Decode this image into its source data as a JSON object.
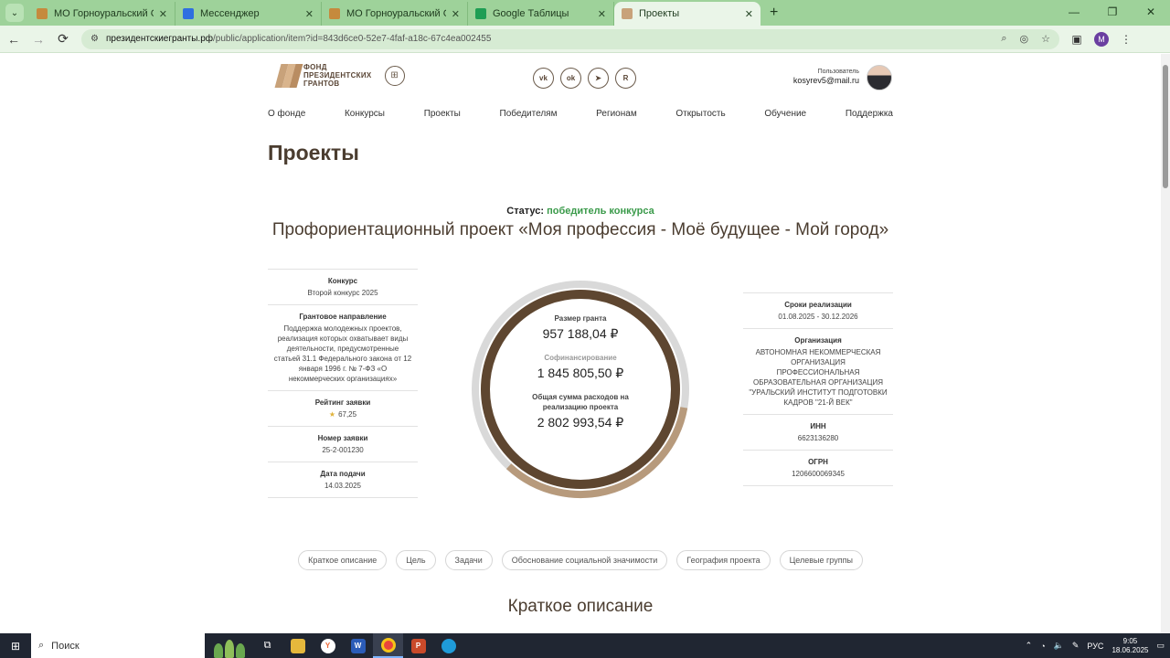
{
  "browser": {
    "tabs": [
      {
        "title": "МО Горноуральский Свердло",
        "icon_color": "#c58a3d",
        "active": false
      },
      {
        "title": "Мессенджер",
        "icon_color": "#2f6fe0",
        "active": false
      },
      {
        "title": "МО Горноуральский Свердло",
        "icon_color": "#c58a3d",
        "active": false
      },
      {
        "title": "Google Таблицы",
        "icon_color": "#1e9e54",
        "active": false
      },
      {
        "title": "Проекты",
        "icon_color": "#c8a27a",
        "active": true
      }
    ],
    "url_host": "президентскиегранты.рф",
    "url_path": "/public/application/item?id=843d6ce0-52e7-4faf-a18c-67c4ea002455",
    "profile_letter": "M"
  },
  "site": {
    "logo_line1": "ФОНД",
    "logo_line2": "ПРЕЗИДЕНТСКИХ",
    "logo_line3": "ГРАНТОВ",
    "socials": [
      "vk-icon",
      "ok-icon",
      "telegram-icon",
      "rutube-icon"
    ],
    "user_label": "Пользователь",
    "user_email": "kosyrev5@mail.ru",
    "nav": [
      "О фонде",
      "Конкурсы",
      "Проекты",
      "Победителям",
      "Регионам",
      "Открытость",
      "Обучение",
      "Поддержка"
    ]
  },
  "main": {
    "heading": "Проекты",
    "status_label": "Статус:",
    "status_value": "победитель конкурса",
    "project_title": "Профориентационный проект «Моя профессия - Моё будущее - Мой город»",
    "left": [
      {
        "k": "Конкурс",
        "v": "Второй конкурс 2025"
      },
      {
        "k": "Грантовое направление",
        "v": "Поддержка молодежных проектов, реализация которых охватывает виды деятельности, предусмотренные статьей 31.1 Федерального закона от 12 января 1996 г. № 7-ФЗ «О некоммерческих организациях»"
      },
      {
        "k": "Рейтинг заявки",
        "v": "67,25"
      },
      {
        "k": "Номер заявки",
        "v": "25-2-001230"
      },
      {
        "k": "Дата подачи",
        "v": "14.03.2025"
      }
    ],
    "right": [
      {
        "k": "Сроки реализации",
        "v": "01.08.2025 - 30.12.2026"
      },
      {
        "k": "Организация",
        "v": "АВТОНОМНАЯ НЕКОММЕРЧЕСКАЯ ОРГАНИЗАЦИЯ ПРОФЕССИОНАЛЬНАЯ ОБРАЗОВАТЕЛЬНАЯ ОРГАНИЗАЦИЯ \"УРАЛЬСКИЙ ИНСТИТУТ ПОДГОТОВКИ КАДРОВ \"21-Й ВЕК\""
      },
      {
        "k": "ИНН",
        "v": "6623136280"
      },
      {
        "k": "ОГРН",
        "v": "1206600069345"
      }
    ],
    "donut": {
      "grant_label": "Размер гранта",
      "grant_value": "957 188,04 ₽",
      "cofin_label": "Софинансирование",
      "cofin_value": "1 845 805,50 ₽",
      "total_label": "Общая сумма расходов на реализацию проекта",
      "total_value": "2 802 993,54 ₽",
      "colors": {
        "dark": "#5e4630",
        "light": "#b79a7c",
        "track": "#d9d9d9"
      },
      "grant_share": 0.3415
    },
    "pills": [
      "Краткое описание",
      "Цель",
      "Задачи",
      "Обоснование социальной значимости",
      "География проекта",
      "Целевые группы"
    ],
    "section_heading": "Краткое описание"
  },
  "taskbar": {
    "search_label": "Поиск",
    "lang": "РУС",
    "time": "9:05",
    "date": "18.06.2025"
  }
}
